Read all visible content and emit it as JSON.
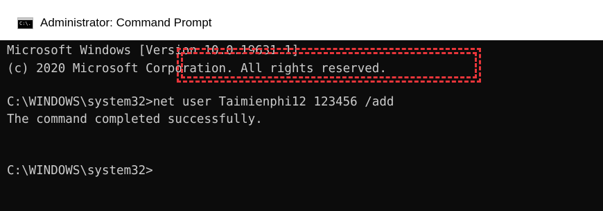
{
  "window": {
    "title": "Administrator: Command Prompt",
    "icon": "cmd-icon",
    "icon_text": "C:\\."
  },
  "console": {
    "lines": [
      "Microsoft Windows [Version 10.0.19631.1]",
      "(c) 2020 Microsoft Corporation. All rights reserved.",
      "C:\\WINDOWS\\system32>net user Taimienphi12 123456 /add",
      "The command completed successfully.",
      "C:\\WINDOWS\\system32>"
    ],
    "background_color": "#0c0c0c",
    "text_color": "#cccccc"
  },
  "annotation": {
    "color": "#e8353a",
    "style": "double-dashed-box"
  }
}
